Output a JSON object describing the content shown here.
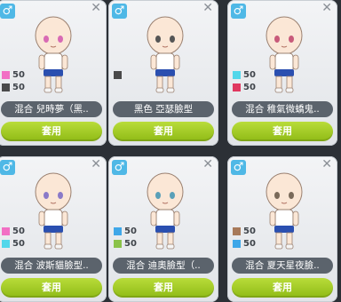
{
  "cards": [
    {
      "gender_icon": "♂",
      "close_icon": "✕",
      "name": "混合 兒時夢（黑..",
      "button": "套用",
      "swatches": [
        {
          "color": "#f26fc4",
          "value": "50"
        },
        {
          "color": "#4a4a4a",
          "value": "50"
        }
      ],
      "eye": "#d86ab4"
    },
    {
      "gender_icon": "♂",
      "close_icon": "✕",
      "name": "黑色 亞瑟臉型",
      "button": "套用",
      "swatches": [
        {
          "color": "#4a4a4a",
          "value": ""
        }
      ],
      "eye": "#555555"
    },
    {
      "gender_icon": "♂",
      "close_icon": "✕",
      "name": "混合 稚氣微蟜鬼..",
      "button": "套用",
      "swatches": [
        {
          "color": "#52d7ea",
          "value": "50"
        },
        {
          "color": "#e0385f",
          "value": "50"
        }
      ],
      "eye": "#c85a7a"
    },
    {
      "gender_icon": "♂",
      "close_icon": "✕",
      "name": "混合 波斯貓臉型..",
      "button": "套用",
      "swatches": [
        {
          "color": "#f26fc4",
          "value": "50"
        },
        {
          "color": "#52d7ea",
          "value": "50"
        }
      ],
      "eye": "#8a7ac8"
    },
    {
      "gender_icon": "♂",
      "close_icon": "✕",
      "name": "混合 迪奧臉型（..",
      "button": "套用",
      "swatches": [
        {
          "color": "#3fa7e8",
          "value": "50"
        },
        {
          "color": "#8bc34a",
          "value": "50"
        }
      ],
      "eye": "#5aa0b8"
    },
    {
      "gender_icon": "♂",
      "close_icon": "✕",
      "name": "混合 夏天星夜臉..",
      "button": "套用",
      "swatches": [
        {
          "color": "#a87a5a",
          "value": "50"
        },
        {
          "color": "#3fa7e8",
          "value": "50"
        }
      ],
      "eye": "#7a6a5a"
    }
  ],
  "colors": {
    "accent_button": "#9cc61e",
    "name_bar": "#5b636c",
    "gender_badge": "#4fb8e6"
  }
}
